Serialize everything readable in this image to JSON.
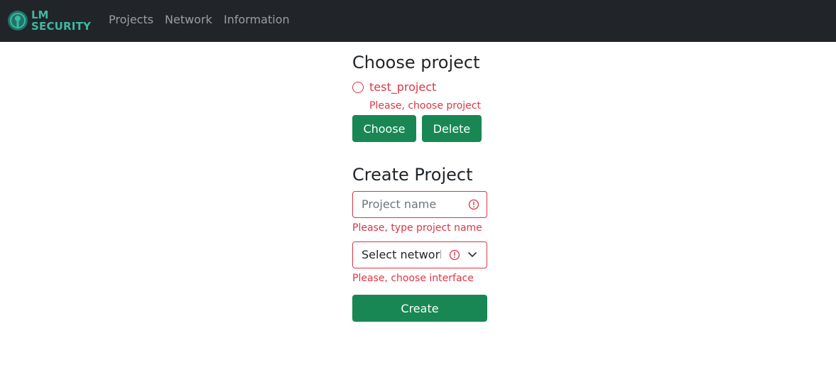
{
  "navbar": {
    "brand": {
      "line1": "LM",
      "line2": "SECURITY"
    },
    "links": [
      {
        "label": "Projects"
      },
      {
        "label": "Network"
      },
      {
        "label": "Information"
      }
    ]
  },
  "choose_section": {
    "title": "Choose project",
    "projects": [
      {
        "label": "test_project",
        "checked": false
      }
    ],
    "error": "Please, choose project",
    "choose_label": "Choose",
    "delete_label": "Delete"
  },
  "create_section": {
    "title": "Create Project",
    "name_input": {
      "value": "",
      "placeholder": "Project name"
    },
    "name_error": "Please, type project name",
    "network_select": {
      "selected": "Select network"
    },
    "network_error": "Please, choose interface",
    "create_label": "Create"
  },
  "colors": {
    "navbar_bg": "#212529",
    "brand": "#3fb8a3",
    "primary_button": "#198754",
    "invalid": "#dc3545"
  },
  "icons": [
    "logo-icon",
    "error-icon",
    "chevron-down-icon"
  ]
}
